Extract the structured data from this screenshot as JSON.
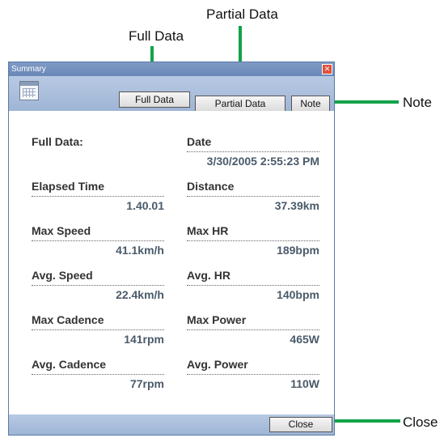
{
  "callouts": {
    "full_data": "Full Data",
    "partial_data": "Partial Data",
    "note": "Note",
    "close": "Close"
  },
  "window": {
    "title": "Summary",
    "close_glyph": "✕"
  },
  "toolbar": {
    "icon": "calendar-icon",
    "full_data_label": "Full Data",
    "partial_data_label": "Partial Data",
    "note_label": "Note"
  },
  "summary": {
    "section_label": "Full Data:",
    "date_label": "Date",
    "date_value": "3/30/2005 2:55:23 PM",
    "rows": [
      {
        "left_label": "Elapsed Time",
        "left_value": "1.40.01",
        "right_label": "Distance",
        "right_value": "37.39km"
      },
      {
        "left_label": "Max Speed",
        "left_value": "41.1km/h",
        "right_label": "Max HR",
        "right_value": "189bpm"
      },
      {
        "left_label": "Avg. Speed",
        "left_value": "22.4km/h",
        "right_label": "Avg. HR",
        "right_value": "140bpm"
      },
      {
        "left_label": "Max Cadence",
        "left_value": "141rpm",
        "right_label": "Max Power",
        "right_value": "465W"
      },
      {
        "left_label": "Avg. Cadence",
        "left_value": "77rpm",
        "right_label": "Avg. Power",
        "right_value": "110W"
      }
    ]
  },
  "footer": {
    "close_label": "Close"
  },
  "colors": {
    "callout_line": "#12a34a",
    "titlebar": "#7f9ac4",
    "toolbar": "#b8c9e2"
  }
}
